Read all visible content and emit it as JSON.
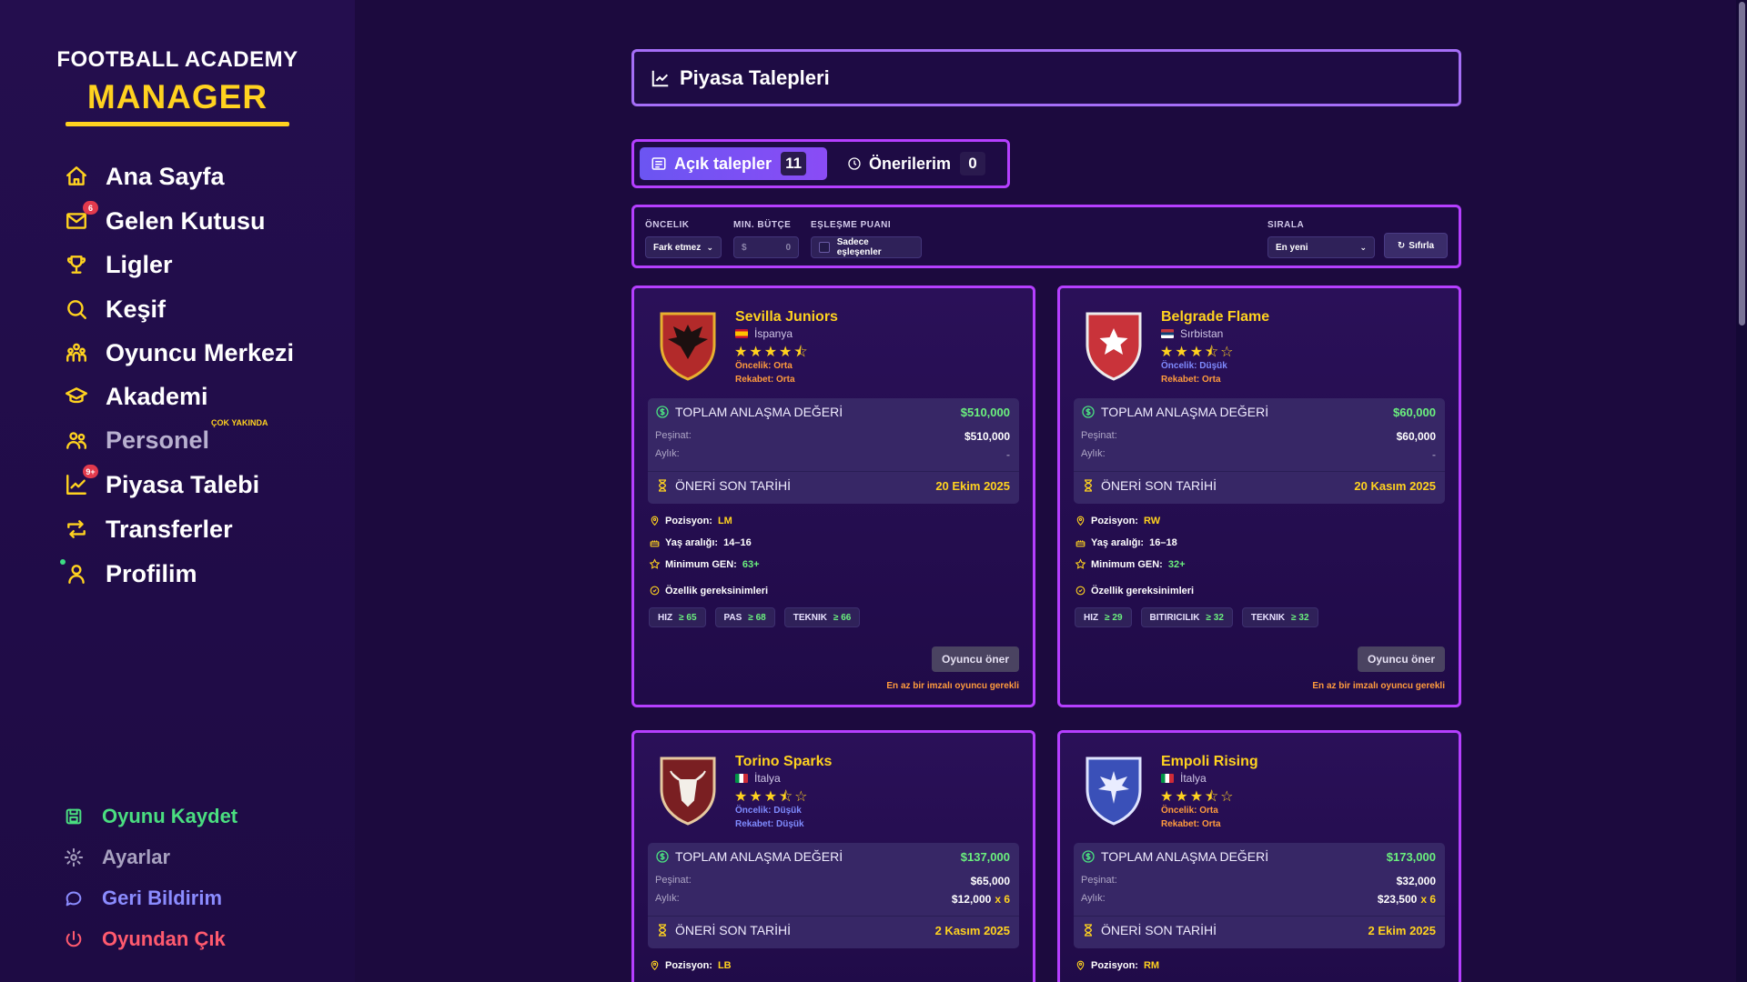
{
  "app": {
    "title_top": "FOOTBALL ACADEMY",
    "title_main": "MANAGER"
  },
  "sidebar": {
    "items": [
      {
        "label": "Ana Sayfa",
        "icon": "home-icon"
      },
      {
        "label": "Gelen Kutusu",
        "icon": "inbox-icon",
        "badge": "6"
      },
      {
        "label": "Ligler",
        "icon": "trophy-icon"
      },
      {
        "label": "Keşif",
        "icon": "search-icon"
      },
      {
        "label": "Oyuncu Merkezi",
        "icon": "players-icon"
      },
      {
        "label": "Akademi",
        "icon": "graduation-cap-icon"
      },
      {
        "label": "Personel",
        "icon": "staff-icon",
        "tag": "ÇOK YAKINDA"
      },
      {
        "label": "Piyasa Talebi",
        "icon": "chart-icon",
        "badge": "9+"
      },
      {
        "label": "Transferler",
        "icon": "transfer-icon"
      },
      {
        "label": "Profilim",
        "icon": "profile-icon"
      }
    ],
    "bottom": [
      {
        "label": "Oyunu Kaydet",
        "icon": "save-icon",
        "color": "#4ade80"
      },
      {
        "label": "Ayarlar",
        "icon": "gear-icon",
        "color": "#a8a1c0"
      },
      {
        "label": "Geri Bildirim",
        "icon": "feedback-icon",
        "color": "#8b8cff"
      },
      {
        "label": "Oyundan Çık",
        "icon": "power-icon",
        "color": "#ff5a6e"
      }
    ]
  },
  "header": {
    "title": "Piyasa Talepleri"
  },
  "tabs": [
    {
      "label": "Açık talepler",
      "count": "11"
    },
    {
      "label": "Önerilerim",
      "count": "0"
    }
  ],
  "filters": {
    "priority_label": "ÖNCELIK",
    "priority_value": "Fark etmez",
    "budget_label": "MIN. BÜTÇE",
    "budget_prefix": "$",
    "budget_value": "0",
    "match_label": "EŞLEŞME PUANI",
    "match_checkbox": "Sadece eşleşenler",
    "sort_label": "SIRALA",
    "sort_value": "En yeni",
    "reset_label": "Sıfırla"
  },
  "card_labels": {
    "total_value": "TOPLAM ANLAŞMA DEĞERİ",
    "upfront": "Peşinat:",
    "monthly": "Aylık:",
    "deadline": "ÖNERİ SON TARİHİ",
    "position": "Pozisyon:",
    "age_range": "Yaş aralığı:",
    "min_gen": "Minimum GEN:",
    "attr_req": "Özellik gereksinimleri",
    "offer_button": "Oyuncu öner",
    "offer_note": "En az bir imzalı oyuncu gerekli"
  },
  "cards": [
    {
      "club": "Sevilla Juniors",
      "country": "İspanya",
      "rating": 4.5,
      "stars": "★★★★⯪",
      "priority": "Öncelik: Orta",
      "priority_color": "#ff9b3d",
      "rivalry": "Rekabet: Orta",
      "rivalry_color": "#ff9b3d",
      "total": "$510,000",
      "upfront": "$510,000",
      "monthly": "-",
      "monthly_mult": "",
      "deadline": "20 Ekim 2025",
      "position": "LM",
      "age": "14–16",
      "min_gen": "63+",
      "attrs": [
        {
          "name": "HIZ",
          "val": "≥ 65"
        },
        {
          "name": "PAS",
          "val": "≥ 68"
        },
        {
          "name": "TEKNIK",
          "val": "≥ 66"
        }
      ],
      "crest_color": "#b22a2a",
      "crest_icon": "eagle-icon"
    },
    {
      "club": "Belgrade Flame",
      "country": "Sırbistan",
      "rating": 3.5,
      "stars": "★★★⯪☆",
      "priority": "Öncelik: Düşük",
      "priority_color": "#7f8bff",
      "rivalry": "Rekabet: Orta",
      "rivalry_color": "#ff9b3d",
      "total": "$60,000",
      "upfront": "$60,000",
      "monthly": "-",
      "monthly_mult": "",
      "deadline": "20 Kasım 2025",
      "position": "RW",
      "age": "16–18",
      "min_gen": "32+",
      "attrs": [
        {
          "name": "HIZ",
          "val": "≥ 29"
        },
        {
          "name": "BITIRICILIK",
          "val": "≥ 32"
        },
        {
          "name": "TEKNIK",
          "val": "≥ 32"
        }
      ],
      "crest_color": "#c9333a",
      "crest_icon": "star-icon"
    },
    {
      "club": "Torino Sparks",
      "country": "İtalya",
      "rating": 3.5,
      "stars": "★★★⯪☆",
      "priority": "Öncelik: Düşük",
      "priority_color": "#7f8bff",
      "rivalry": "Rekabet: Düşük",
      "rivalry_color": "#7f8bff",
      "total": "$137,000",
      "upfront": "$65,000",
      "monthly": "$12,000",
      "monthly_mult": "x 6",
      "deadline": "2 Kasım 2025",
      "position": "LB",
      "age": "",
      "min_gen": "",
      "attrs": [],
      "crest_color": "#7a1f22",
      "crest_icon": "bull-icon"
    },
    {
      "club": "Empoli Rising",
      "country": "İtalya",
      "rating": 3.5,
      "stars": "★★★⯪☆",
      "priority": "Öncelik: Orta",
      "priority_color": "#ff9b3d",
      "rivalry": "Rekabet: Orta",
      "rivalry_color": "#ff9b3d",
      "total": "$173,000",
      "upfront": "$32,000",
      "monthly": "$23,500",
      "monthly_mult": "x 6",
      "deadline": "2 Ekim 2025",
      "position": "RM",
      "age": "",
      "min_gen": "",
      "attrs": [],
      "crest_color": "#3a50b8",
      "crest_icon": "phoenix-icon"
    }
  ]
}
